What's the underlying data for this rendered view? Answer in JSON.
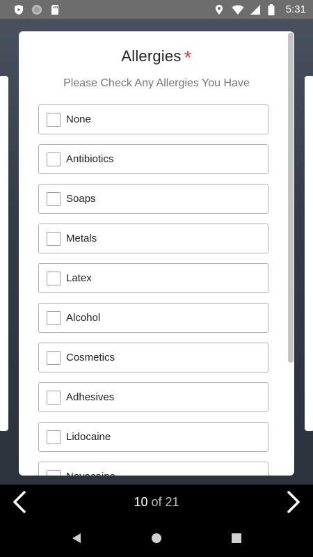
{
  "status_bar": {
    "time": "5:31"
  },
  "form": {
    "title": "Allergies",
    "required_marker": "*",
    "subtitle": "Please Check Any Allergies You Have",
    "options": [
      {
        "label": "None",
        "checked": false
      },
      {
        "label": "Antibiotics",
        "checked": false
      },
      {
        "label": "Soaps",
        "checked": false
      },
      {
        "label": "Metals",
        "checked": false
      },
      {
        "label": "Latex",
        "checked": false
      },
      {
        "label": "Alcohol",
        "checked": false
      },
      {
        "label": "Cosmetics",
        "checked": false
      },
      {
        "label": "Adhesives",
        "checked": false
      },
      {
        "label": "Lidocaine",
        "checked": false
      },
      {
        "label": "Novocaine",
        "checked": false
      }
    ]
  },
  "pager": {
    "current": "10",
    "of_label": "of",
    "total": "21"
  },
  "colors": {
    "required": "#e53935",
    "nav_background": "#000000"
  }
}
